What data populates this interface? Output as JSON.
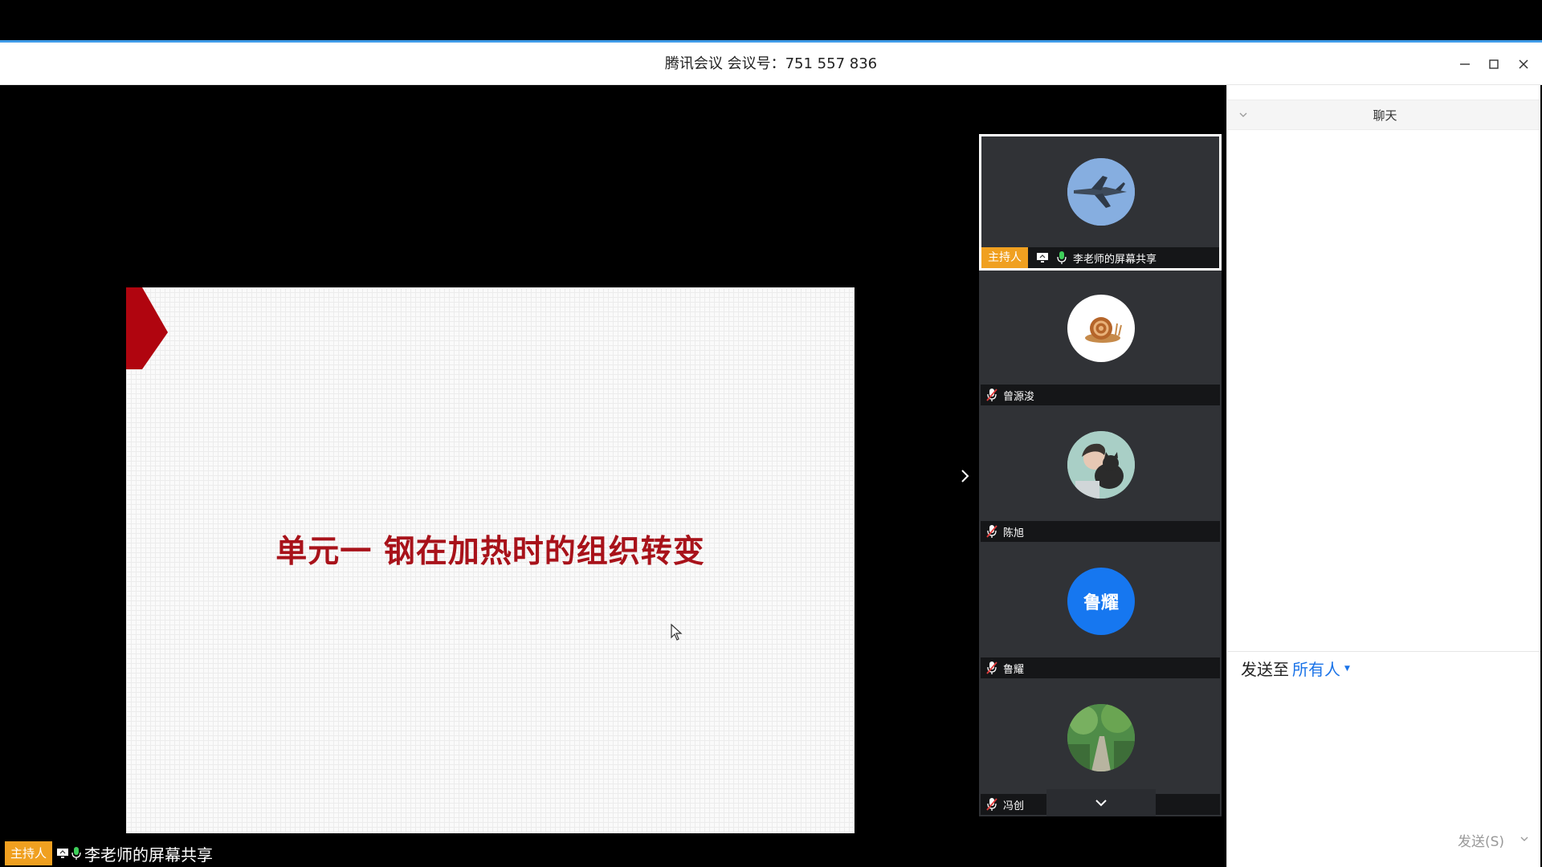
{
  "window": {
    "title": "腾讯会议 会议号：751 557 836"
  },
  "slide": {
    "title": "单元一 钢在加热时的组织转变"
  },
  "participants": [
    {
      "name": "李老师的屏幕共享",
      "host_label": "主持人",
      "avatar": "fighter-jet-photo",
      "muted": false,
      "sharing": true
    },
    {
      "name": "曾源浚",
      "avatar": "snail-emoji",
      "muted": true
    },
    {
      "name": "陈旭",
      "avatar": "person-with-cat-photo",
      "muted": true
    },
    {
      "name": "鲁耀",
      "avatar_text": "鲁耀",
      "avatar_color": "#1677f0",
      "muted": true
    },
    {
      "name": "冯创",
      "avatar": "forest-path-photo",
      "muted": true
    }
  ],
  "bottom_bar": {
    "host_label": "主持人",
    "name": "李老师的屏幕共享"
  },
  "chat": {
    "title": "聊天",
    "send_to_label": "发送至",
    "recipient": "所有人",
    "send_button": "发送(S)"
  },
  "colors": {
    "accent": "#3f9be8",
    "host_tag": "#f0a020",
    "slide_title": "#a8121a",
    "link": "#1a73e8"
  }
}
